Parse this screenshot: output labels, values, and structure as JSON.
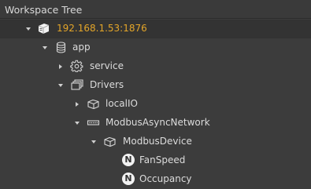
{
  "panel": {
    "title": "Workspace Tree"
  },
  "tree": {
    "nodes": [
      {
        "label": "192.168.1.53:1876",
        "icon": "server-icon",
        "expanded": true,
        "selected": true
      },
      {
        "label": "app",
        "icon": "database-icon",
        "expanded": true
      },
      {
        "label": "service",
        "icon": "gear-icon",
        "expanded": false
      },
      {
        "label": "Drivers",
        "icon": "drivers-stack-icon",
        "expanded": true
      },
      {
        "label": "localIO",
        "icon": "io-device-icon",
        "expanded": false
      },
      {
        "label": "ModbusAsyncNetwork",
        "icon": "network-icon",
        "expanded": true
      },
      {
        "label": "ModbusDevice",
        "icon": "device-icon",
        "expanded": true
      },
      {
        "label": "FanSpeed",
        "icon": "numeric-point-icon",
        "badge": "N"
      },
      {
        "label": "Occupancy",
        "icon": "numeric-point-icon",
        "badge": "N"
      }
    ]
  },
  "colors": {
    "background": "#3c3c3c",
    "selected_text": "#e3a529",
    "text": "#dcdcdc"
  }
}
